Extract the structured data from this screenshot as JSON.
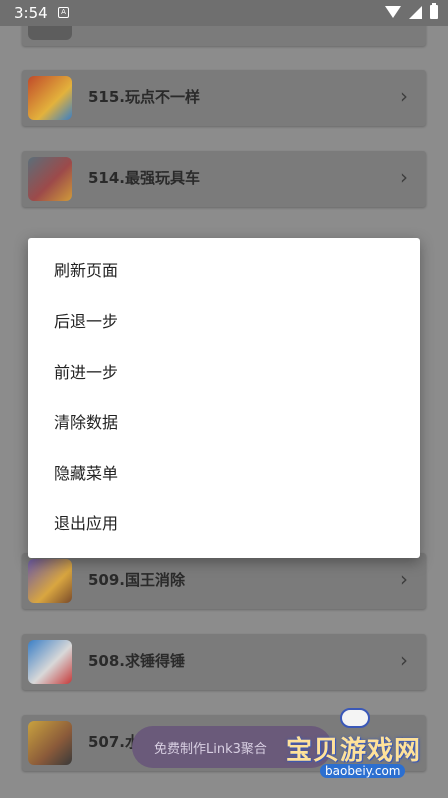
{
  "status_bar": {
    "time": "3:54",
    "notification_glyph": "A"
  },
  "list": {
    "items": [
      {
        "label": "515.玩点不一样",
        "thumb_color": "#c04a2a"
      },
      {
        "label": "514.最强玩具车",
        "thumb_color": "#5b6f7a"
      },
      {
        "label": "509.国王消除",
        "thumb_color": "#6b5aa8"
      },
      {
        "label": "508.求锤得锤",
        "thumb_color": "#3a7fc6"
      },
      {
        "label": "507.水",
        "thumb_color": "#c9a23f"
      }
    ]
  },
  "menu": {
    "items": [
      "刷新页面",
      "后退一步",
      "前进一步",
      "清除数据",
      "隐藏菜单",
      "退出应用"
    ]
  },
  "promo": {
    "text": "免费制作Link3聚合"
  },
  "watermark": {
    "text": "宝贝游戏网",
    "url": "baobeiy.com"
  }
}
